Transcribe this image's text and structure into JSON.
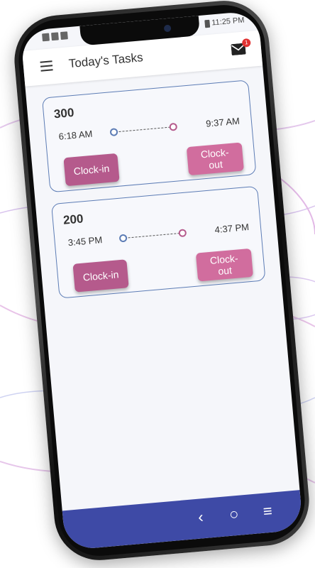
{
  "status_bar": {
    "time": "11:25 PM"
  },
  "app_bar": {
    "title": "Today's Tasks",
    "menu_icon": "hamburger-menu-icon",
    "mail_icon": "envelope-icon",
    "mail_badge": "1"
  },
  "tasks": [
    {
      "number": "300",
      "start_time": "6:18 AM",
      "end_time": "9:37 AM",
      "clock_in_label": "Clock-in",
      "clock_out_label": "Clock-out"
    },
    {
      "number": "200",
      "start_time": "3:45 PM",
      "end_time": "4:37 PM",
      "clock_in_label": "Clock-in",
      "clock_out_label": "Clock-out"
    }
  ],
  "nav_bar": {
    "back_icon": "back-chevron-icon",
    "home_icon": "home-circle-icon",
    "recent_icon": "recent-apps-icon"
  },
  "colors": {
    "card_border": "#5c7cb5",
    "clock_in": "#b55a8c",
    "clock_out": "#d16d9e",
    "nav_bar": "#3e4aa6"
  }
}
